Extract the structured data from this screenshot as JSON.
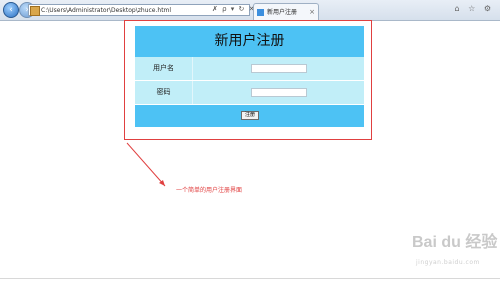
{
  "browser": {
    "address": "C:\\Users\\Administrator\\Desktop\\zhuce.html",
    "address_tools": "✗ ρ ▾ ↻ ✕",
    "tab_title": "新用户注册",
    "tab_close": "×",
    "right_icons": "⌂ ☆ ⚙"
  },
  "form": {
    "title": "新用户注册",
    "username_label": "用户名",
    "password_label": "密码",
    "username_value": "",
    "password_value": "",
    "submit_label": "注册"
  },
  "annotation": {
    "caption": "一个简单的用户注册界面"
  },
  "watermark": {
    "logo": "Bai du 经验",
    "sub": "jingyan.baidu.com"
  }
}
